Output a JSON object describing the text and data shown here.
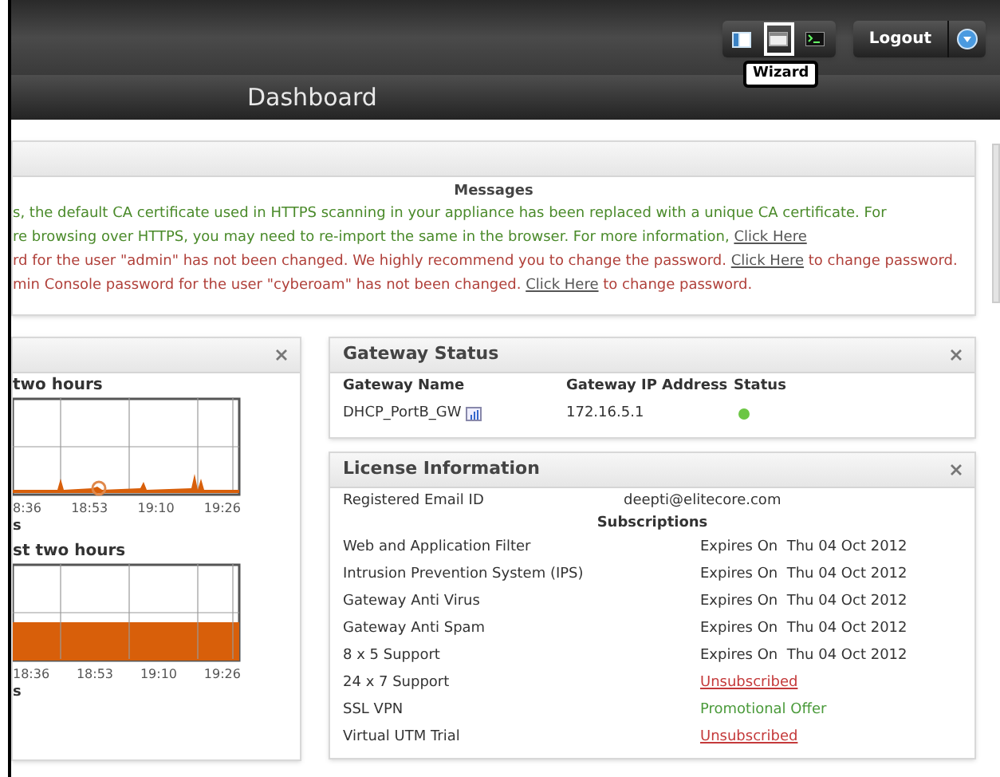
{
  "header": {
    "toolbar": [
      {
        "kind": "panel",
        "selected": false
      },
      {
        "kind": "wizard",
        "selected": true
      },
      {
        "kind": "console",
        "selected": false
      }
    ],
    "tooltip": "Wizard",
    "logout": "Logout"
  },
  "title": "Dashboard",
  "messages": {
    "heading": "Messages",
    "lines": [
      {
        "color": "#4a8a2a",
        "text": "s, the default CA certificate used in HTTPS scanning in your appliance has been replaced with a unique CA certificate. For"
      },
      {
        "color": "#4a8a2a",
        "text": "re browsing over HTTPS, you may need to re-import the same in the browser. For more information, ",
        "link": "Click Here"
      },
      {
        "color": "#b0403a",
        "text": "rd for the user \"admin\" has not been changed. We highly recommend you to change the password. ",
        "link": "Click Here",
        "after": " to change password."
      },
      {
        "color": "#b0403a",
        "text": "min Console password for the user \"cyberoam\" has not been changed. ",
        "link": "Click Here",
        "after": " to change password."
      }
    ]
  },
  "traffic_panel": {
    "charts": [
      {
        "title": "two hours",
        "ticks": [
          "8:36",
          "18:53",
          "19:10",
          "19:26"
        ],
        "unit": "s",
        "kind": "line"
      },
      {
        "title": "st two hours",
        "ticks": [
          "18:36",
          "18:53",
          "19:10",
          "19:26"
        ],
        "unit": "s",
        "kind": "area"
      }
    ]
  },
  "gateway_status": {
    "title": "Gateway Status",
    "columns": [
      "Gateway Name",
      "Gateway IP Address",
      "Status"
    ],
    "rows": [
      {
        "name": "DHCP_PortB_GW",
        "ip": "172.16.5.1",
        "color": "#6cc644"
      }
    ]
  },
  "license": {
    "title": "License Information",
    "email_label": "Registered Email ID",
    "email": "deepti@elitecore.com",
    "subscriptions_heading": "Subscriptions",
    "rows": [
      {
        "name": "Web and Application Filter",
        "kind": "expiry",
        "prefix": "Expires On",
        "value": "Thu 04 Oct 2012"
      },
      {
        "name": "Intrusion Prevention System (IPS)",
        "kind": "expiry",
        "prefix": "Expires On",
        "value": "Thu 04 Oct 2012"
      },
      {
        "name": "Gateway Anti Virus",
        "kind": "expiry",
        "prefix": "Expires On",
        "value": "Thu 04 Oct 2012"
      },
      {
        "name": "Gateway Anti Spam",
        "kind": "expiry",
        "prefix": "Expires On",
        "value": "Thu 04 Oct 2012"
      },
      {
        "name": "8 x 5 Support",
        "kind": "expiry",
        "prefix": "Expires On",
        "value": "Thu 04 Oct 2012"
      },
      {
        "name": "24 x 7 Support",
        "kind": "unsubscribed",
        "value": "Unsubscribed"
      },
      {
        "name": "SSL VPN",
        "kind": "offer",
        "value": "Promotional Offer"
      },
      {
        "name": "Virtual UTM Trial",
        "kind": "unsubscribed",
        "value": "Unsubscribed"
      }
    ]
  }
}
